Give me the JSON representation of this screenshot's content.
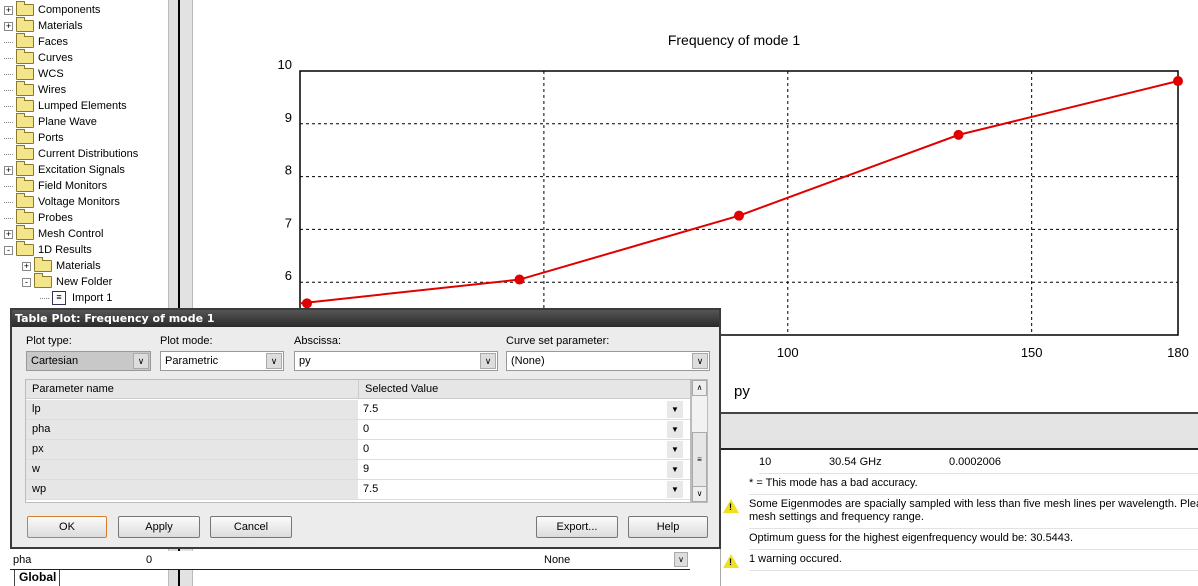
{
  "tree": {
    "items": [
      {
        "label": "Components",
        "exp": "+",
        "indent": 0
      },
      {
        "label": "Materials",
        "exp": "+",
        "indent": 0
      },
      {
        "label": "Faces",
        "exp": "",
        "indent": 0
      },
      {
        "label": "Curves",
        "exp": "",
        "indent": 0
      },
      {
        "label": "WCS",
        "exp": "",
        "indent": 0
      },
      {
        "label": "Wires",
        "exp": "",
        "indent": 0
      },
      {
        "label": "Lumped Elements",
        "exp": "",
        "indent": 0
      },
      {
        "label": "Plane Wave",
        "exp": "",
        "indent": 0
      },
      {
        "label": "Ports",
        "exp": "",
        "indent": 0
      },
      {
        "label": "Current Distributions",
        "exp": "",
        "indent": 0
      },
      {
        "label": "Excitation Signals",
        "exp": "+",
        "indent": 0
      },
      {
        "label": "Field Monitors",
        "exp": "",
        "indent": 0
      },
      {
        "label": "Voltage Monitors",
        "exp": "",
        "indent": 0
      },
      {
        "label": "Probes",
        "exp": "",
        "indent": 0
      },
      {
        "label": "Mesh Control",
        "exp": "+",
        "indent": 0
      },
      {
        "label": "1D Results",
        "exp": "-",
        "indent": 0
      },
      {
        "label": "Materials",
        "exp": "+",
        "indent": 1
      },
      {
        "label": "New Folder",
        "exp": "-",
        "indent": 1
      },
      {
        "label": "Import 1",
        "exp": "",
        "indent": 2,
        "file": true
      }
    ]
  },
  "chart_data": {
    "type": "line",
    "title": "Frequency of mode 1",
    "xlabel": "py",
    "ylabel": "",
    "x": [
      0,
      45,
      90,
      135,
      180
    ],
    "y": [
      5.6,
      6.05,
      7.26,
      8.79,
      9.81
    ],
    "xlim": [
      0,
      180
    ],
    "ylim": [
      5,
      10
    ],
    "xticks": [
      100,
      150,
      180
    ],
    "xgrid": [
      50,
      100,
      150
    ],
    "yticks": [
      6,
      7,
      8,
      9,
      10
    ],
    "color": "#e00000",
    "grid": "dashed"
  },
  "dialog": {
    "title": "Table Plot: Frequency of mode 1",
    "plot_type_label": "Plot type:",
    "plot_type": "Cartesian",
    "plot_mode_label": "Plot mode:",
    "plot_mode": "Parametric",
    "abscissa_label": "Abscissa:",
    "abscissa": "py",
    "curve_set_label": "Curve set parameter:",
    "curve_set": "(None)",
    "col_name": "Parameter name",
    "col_value": "Selected Value",
    "rows": [
      {
        "name": "lp",
        "value": "7.5"
      },
      {
        "name": "pha",
        "value": "0"
      },
      {
        "name": "px",
        "value": "0"
      },
      {
        "name": "w",
        "value": "9"
      },
      {
        "name": "wp",
        "value": "7.5"
      }
    ],
    "ok": "OK",
    "apply": "Apply",
    "cancel": "Cancel",
    "export": "Export...",
    "help": "Help"
  },
  "param_list": {
    "name": "pha",
    "value": "0",
    "type": "None",
    "tab": "Global"
  },
  "messages": {
    "row": {
      "mode": "10",
      "freq": "30.54 GHz",
      "acc": "0.0002006"
    },
    "note": "* = This mode has a bad accuracy.",
    "warn1": "Some Eigenmodes are spacially sampled with less than five mesh lines per wavelength. Please c",
    "warn1b": "mesh settings and frequency range.",
    "guess": "Optimum guess for the highest eigenfrequency would be: 30.5443.",
    "warn2": "1 warning occured."
  }
}
